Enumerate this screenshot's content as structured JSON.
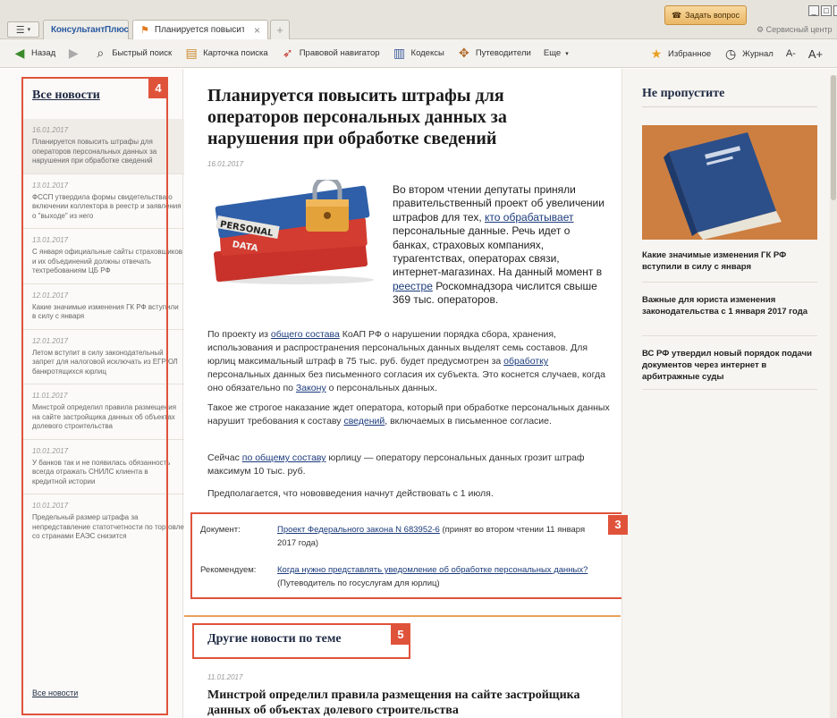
{
  "tabs": {
    "logo_label": "КонсультантПлюс",
    "active_label": "Планируется повысить ш...",
    "close": "×",
    "add": "+"
  },
  "window": {
    "ask_button": "Задать вопрос",
    "service_center": "Сервисный центр"
  },
  "toolbar": {
    "back": "Назад",
    "quick_search": "Быстрый поиск",
    "card_search": "Карточка поиска",
    "legal_navigator": "Правовой навигатор",
    "codes": "Кодексы",
    "guides": "Путеводители",
    "more": "Еще",
    "favorites": "Избранное",
    "journal": "Журнал",
    "font_smaller": "A-",
    "font_larger": "A+"
  },
  "left": {
    "title": "Все новости",
    "items": [
      {
        "date": "16.01.2017",
        "text": "Планируется повысить штрафы для операторов персональных данных за нарушения при обработке сведений"
      },
      {
        "date": "13.01.2017",
        "text": "ФССП утвердила формы свидетельства о включении коллектора в реестр и заявления о \"выходе\" из него"
      },
      {
        "date": "13.01.2017",
        "text": "С января официальные сайты страховщиков и их объединений должны отвечать техтребованиям ЦБ РФ"
      },
      {
        "date": "12.01.2017",
        "text": "Какие значимые изменения ГК РФ вступили в силу с января"
      },
      {
        "date": "12.01.2017",
        "text": "Летом вступит в силу законодательный запрет для налоговой исключать из ЕГРЮЛ банкротящихся юрлиц"
      },
      {
        "date": "11.01.2017",
        "text": "Минстрой определил правила размещения на сайте застройщика данных об объектах долевого строительства"
      },
      {
        "date": "10.01.2017",
        "text": "У банков так и не появилась обязанность всегда отражать СНИЛС клиента в кредитной истории"
      },
      {
        "date": "10.01.2017",
        "text": "Предельный размер штрафа за непредставление статотчетности по торговле со странами ЕАЭС снизится"
      }
    ],
    "all_news": "Все новости"
  },
  "article": {
    "title": "Планируется повысить штрафы для операторов персональных данных за нарушения при обработке сведений",
    "date": "16.01.2017",
    "image_text": [
      "PERSONAL",
      "DATA"
    ],
    "lead": {
      "a": "Во втором чтении депутаты приняли правительственный проект об увеличении штрафов для тех, ",
      "link1": "кто обрабатывает",
      "b": " персональные данные. Речь идет о банках, страховых компаниях, турагентствах, операторах связи, интернет-магазинах. На данный момент в ",
      "link2": "реестре",
      "c": " Роскомнадзора числится свыше 369 тыс. операторов."
    },
    "p1": {
      "a": "По проекту из ",
      "link1": "общего состава",
      "b": " КоАП РФ о нарушении порядка сбора, хранения, использования и распространения персональных данных выделят семь составов. Для юрлиц максимальный штраф в 75 тыс. руб. будет предусмотрен за ",
      "link2": "обработку",
      "c": " персональных данных без письменного согласия их субъекта. Это коснется случаев, когда оно обязательно по ",
      "link3": "Закону",
      "d": " о персональных данных."
    },
    "p2": {
      "a": "Такое же строгое наказание ждет оператора, который при обработке персональных данных нарушит требования к составу ",
      "link1": "сведений",
      "b": ", включаемых в письменное согласие."
    },
    "p3": {
      "a": "Сейчас ",
      "link1": "по общему составу",
      "b": " юрлицу — оператору персональных данных грозит штраф максимум 10 тыс. руб."
    },
    "p4": "Предполагается, что нововведения начнут действовать с 1 июля.",
    "doc": {
      "label": "Документ:",
      "link": "Проект Федерального закона N 683952-6",
      "rest": " (принят во втором чтении 11 января 2017 года)"
    },
    "rec": {
      "label": "Рекомендуем:",
      "link": "Когда нужно представлять уведомление об обработке персональных данных?",
      "rest": " (Путеводитель по госуслугам для юрлиц)"
    },
    "other_title": "Другие новости по теме",
    "other_date": "11.01.2017",
    "other_headline": "Минстрой определил правила размещения на сайте застройщика данных об объектах долевого строительства"
  },
  "right": {
    "title": "Не пропустите",
    "news": [
      "Какие значимые изменения ГК РФ вступили в силу с января",
      "Важные для юриста изменения законодательства с 1 января 2017 года",
      "ВС РФ утвердил новый порядок подачи документов через интернет в арбитражные суды"
    ]
  },
  "callouts": [
    "4",
    "3",
    "5"
  ],
  "colors": {
    "callout": "#e0533b",
    "link": "#1a3a7a",
    "accent_rule": "#e8a15a"
  }
}
